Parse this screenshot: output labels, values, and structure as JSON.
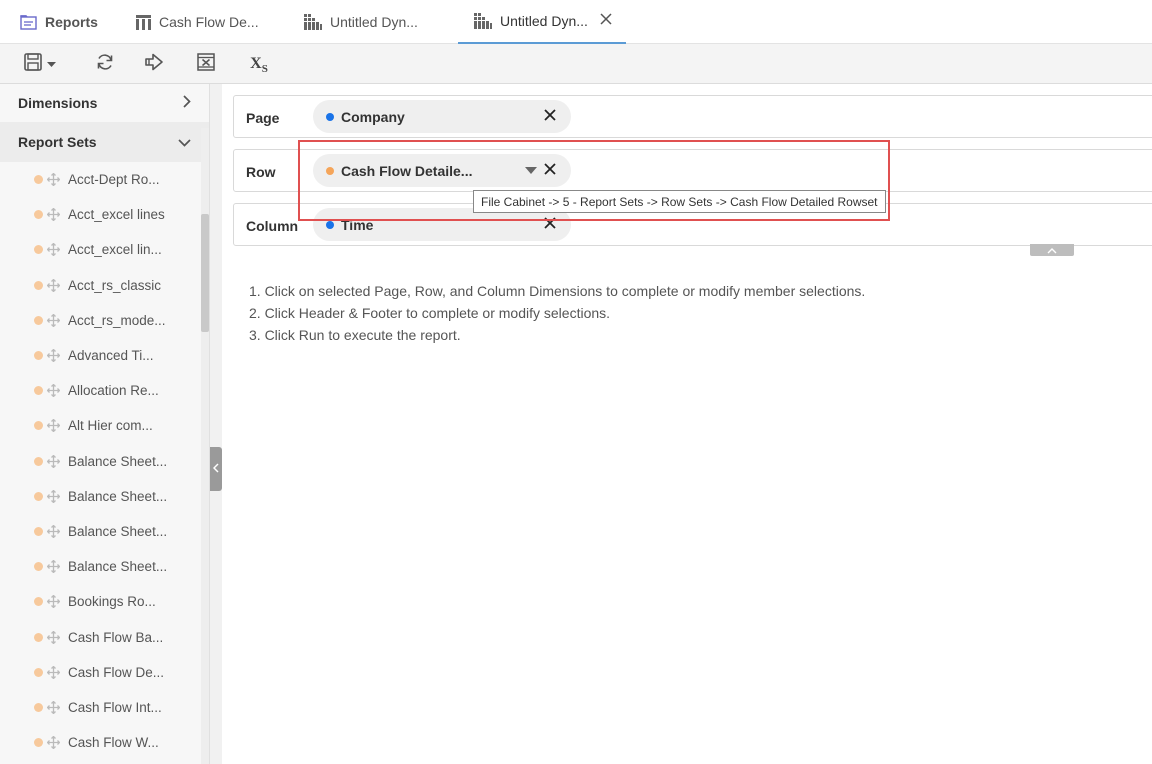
{
  "tabs": {
    "home": "Reports",
    "t1": "Cash Flow De...",
    "t2": "Untitled Dyn...",
    "t3": "Untitled Dyn..."
  },
  "toolbar": {
    "save_icon": "save-icon",
    "refresh_icon": "refresh-icon",
    "run_icon": "run-icon",
    "excel_icon": "excel-icon",
    "xs_label": "X",
    "xs_sub": "S"
  },
  "sidebar": {
    "dimensions_label": "Dimensions",
    "report_sets_label": "Report Sets",
    "items": [
      "Acct-Dept Ro...",
      "Acct_excel lines",
      "Acct_excel lin...",
      "Acct_rs_classic",
      "Acct_rs_mode...",
      "Advanced Ti...",
      "Allocation Re...",
      "Alt Hier com...",
      "Balance Sheet...",
      "Balance Sheet...",
      "Balance Sheet...",
      "Balance Sheet...",
      "Bookings Ro...",
      "Cash Flow Ba...",
      "Cash Flow De...",
      "Cash Flow Int...",
      "Cash Flow W..."
    ]
  },
  "rows": {
    "page": {
      "label": "Page",
      "chip": "Company",
      "color": "#1a73e8"
    },
    "row": {
      "label": "Row",
      "chip": "Cash Flow Detaile...",
      "color": "#f5a55a"
    },
    "column": {
      "label": "Column",
      "chip": "Time",
      "color": "#1a73e8"
    }
  },
  "tooltip": "File Cabinet -> 5 - Report Sets -> Row Sets -> Cash Flow Detailed Rowset",
  "instructions": [
    "1. Click on selected Page, Row, and Column Dimensions to complete or modify member selections.",
    "2. Click Header & Footer to complete or modify selections.",
    "3. Click Run to execute the report."
  ]
}
